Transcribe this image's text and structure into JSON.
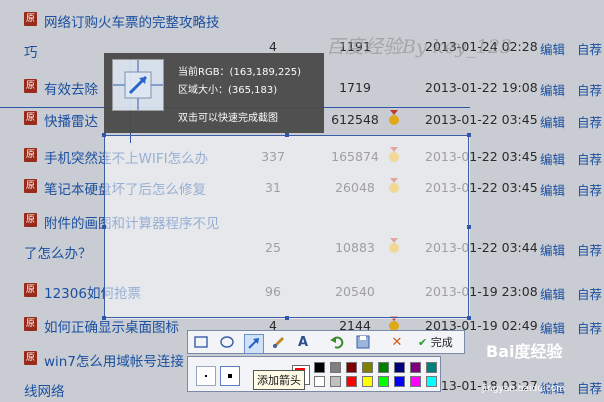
{
  "rows": [
    {
      "title": "网络订购火车票的完整攻略技",
      "title2": "巧",
      "c1": "4",
      "c2": "1191",
      "medal": false,
      "date": "2013-01-24 02:28",
      "edit": "编辑",
      "rec": "自荐"
    },
    {
      "title": "有效去除",
      "title2": "",
      "c1": "",
      "c2": "1719",
      "medal": false,
      "date": "2013-01-22 19:08",
      "edit": "编辑",
      "rec": "自荐"
    },
    {
      "title": "快播雷达",
      "title2": "",
      "c1": "",
      "c2": "612548",
      "medal": true,
      "date": "2013-01-22 03:45",
      "edit": "编辑",
      "rec": "自荐"
    },
    {
      "title": "手机突然连不上WIFI怎么办",
      "title2": "",
      "c1": "337",
      "c2": "165874",
      "medal": true,
      "date": "2013-01-22 03:45",
      "edit": "编辑",
      "rec": "自荐"
    },
    {
      "title": "笔记本硬盘坏了后怎么修复",
      "title2": "",
      "c1": "31",
      "c2": "26048",
      "medal": true,
      "date": "2013-01-22 03:45",
      "edit": "编辑",
      "rec": "自荐"
    },
    {
      "title": "附件的画图和计算器程序不见",
      "title2": "了怎么办？",
      "c1": "25",
      "c2": "10883",
      "medal": true,
      "date": "2013-01-22 03:44",
      "edit": "编辑",
      "rec": "自荐"
    },
    {
      "title": "12306如何抢票",
      "title2": "",
      "c1": "96",
      "c2": "20540",
      "medal": false,
      "date": "2013-01-19 23:08",
      "edit": "编辑",
      "rec": "自荐"
    },
    {
      "title": "如何正确显示桌面图标",
      "title2": "",
      "c1": "4",
      "c2": "2144",
      "medal": true,
      "date": "2013-01-19 02:49",
      "edit": "编辑",
      "rec": "自荐"
    },
    {
      "title": "win7怎么用域帐号连接",
      "title2": "线网络",
      "c1": "",
      "c2": "",
      "medal": false,
      "date": "2013-01-18 03:27",
      "edit": "编辑",
      "rec": "自荐"
    }
  ],
  "row_icon_text": "原",
  "info": {
    "rgb": "当前RGB：(163,189,225)",
    "size": "区域大小：(365,183)",
    "hint": "双击可以快速完成截图"
  },
  "toolbar": {
    "done_label": "完成",
    "tooltip": "添加箭头"
  },
  "colors": [
    "#000000",
    "#7f7f7f",
    "#7f0000",
    "#7f7f00",
    "#007f00",
    "#00007f",
    "#7f007f",
    "#007f7f",
    "#ffffff",
    "#c0c0c0",
    "#ff0000",
    "#ffff00",
    "#00ff00",
    "#0000ff",
    "#ff00ff",
    "#00ffff"
  ],
  "current_color": "#ff0000",
  "watermark": "百度经验By key_123",
  "brand": "Bai度经验",
  "brand_url": "jingyan.baidu.com"
}
